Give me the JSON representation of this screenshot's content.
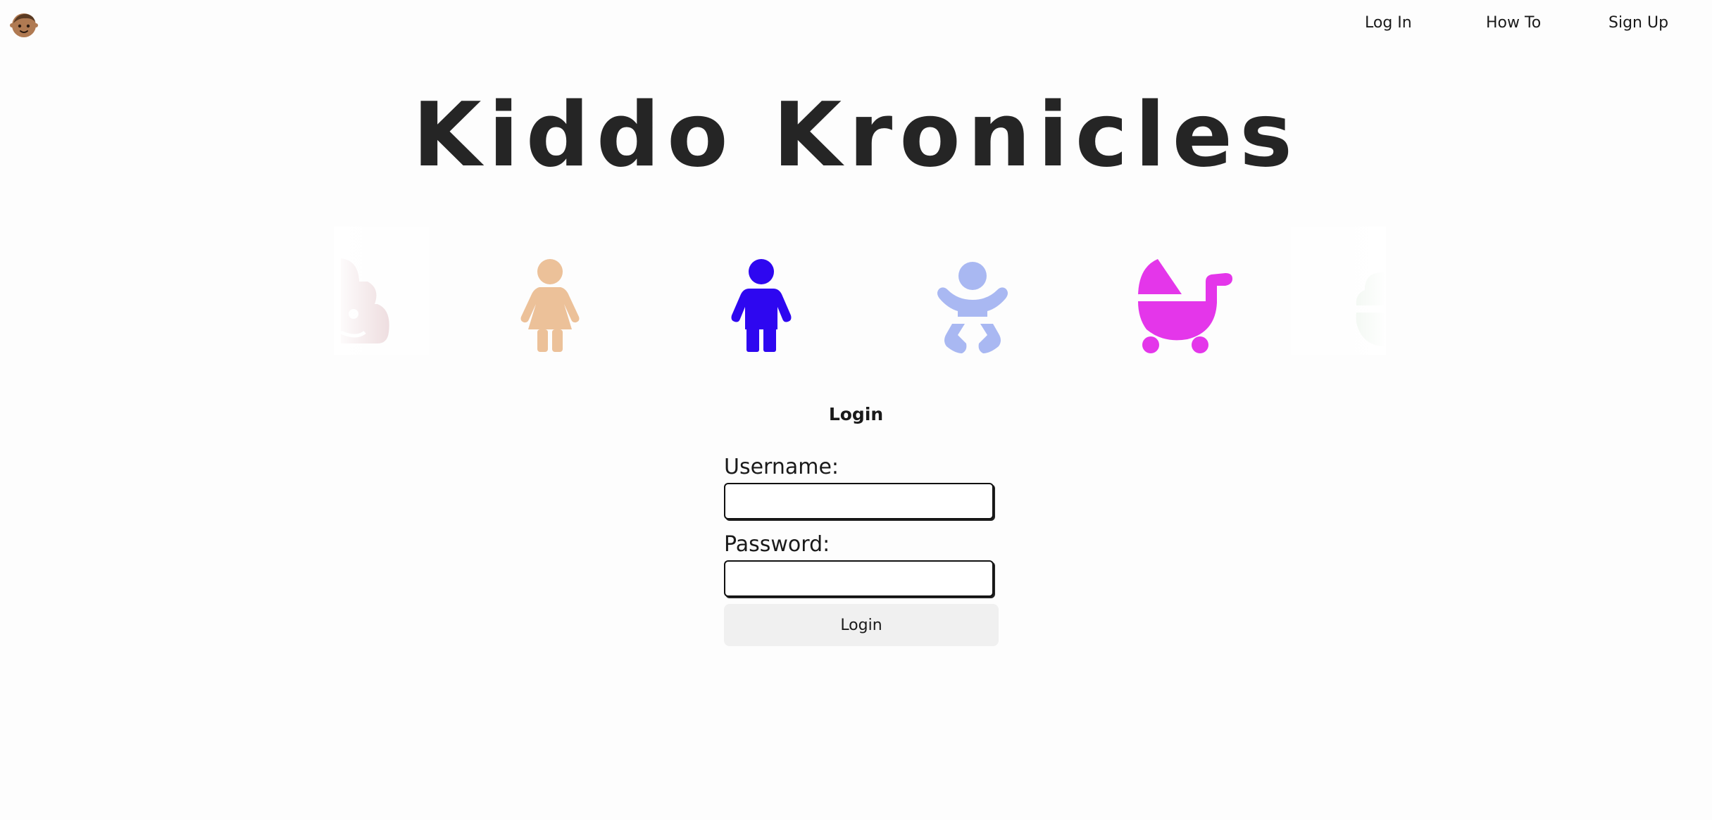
{
  "header": {
    "logo_icon": "baby-face-icon",
    "nav": [
      {
        "label": "Log In"
      },
      {
        "label": "How To"
      },
      {
        "label": "Sign Up"
      }
    ]
  },
  "hero": {
    "title": "Kiddo Kronicles"
  },
  "carousel": {
    "items": [
      {
        "icon": "poop-icon",
        "color": "#d9b3b8"
      },
      {
        "icon": "girl-icon",
        "color": "#ecc199"
      },
      {
        "icon": "boy-icon",
        "color": "#2e07f0"
      },
      {
        "icon": "baby-icon",
        "color": "#a9b8f2"
      },
      {
        "icon": "stroller-icon",
        "color": "#e436ea"
      },
      {
        "icon": "ice-cream-icon",
        "color": "#cfe3cf"
      }
    ]
  },
  "login": {
    "heading": "Login",
    "username_label": "Username:",
    "username_value": "",
    "password_label": "Password:",
    "password_value": "",
    "submit_label": "Login"
  }
}
